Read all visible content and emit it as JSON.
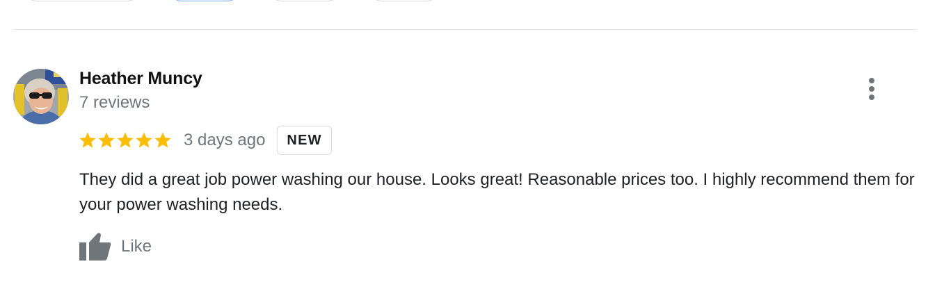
{
  "filter_chips": [
    {
      "label": "",
      "selected": false
    },
    {
      "label": "",
      "selected": true
    },
    {
      "label": "",
      "selected": false
    },
    {
      "label": "",
      "selected": false
    }
  ],
  "review": {
    "reviewer_name": "Heather Muncy",
    "reviewer_meta": "7 reviews",
    "rating": 5,
    "rating_max": 5,
    "date": "3 days ago",
    "badge": "NEW",
    "text": "They did a great job power washing our house. Looks great! Reasonable prices too. I highly recommend them for your power washing needs.",
    "like_label": "Like"
  },
  "icons": {
    "more": "more-vertical-icon",
    "like": "thumbs-up-icon",
    "star": "star-icon"
  },
  "colors": {
    "star": "#fbbc04",
    "secondary_text": "#70757a",
    "selected_chip": "#e8f0fe"
  }
}
